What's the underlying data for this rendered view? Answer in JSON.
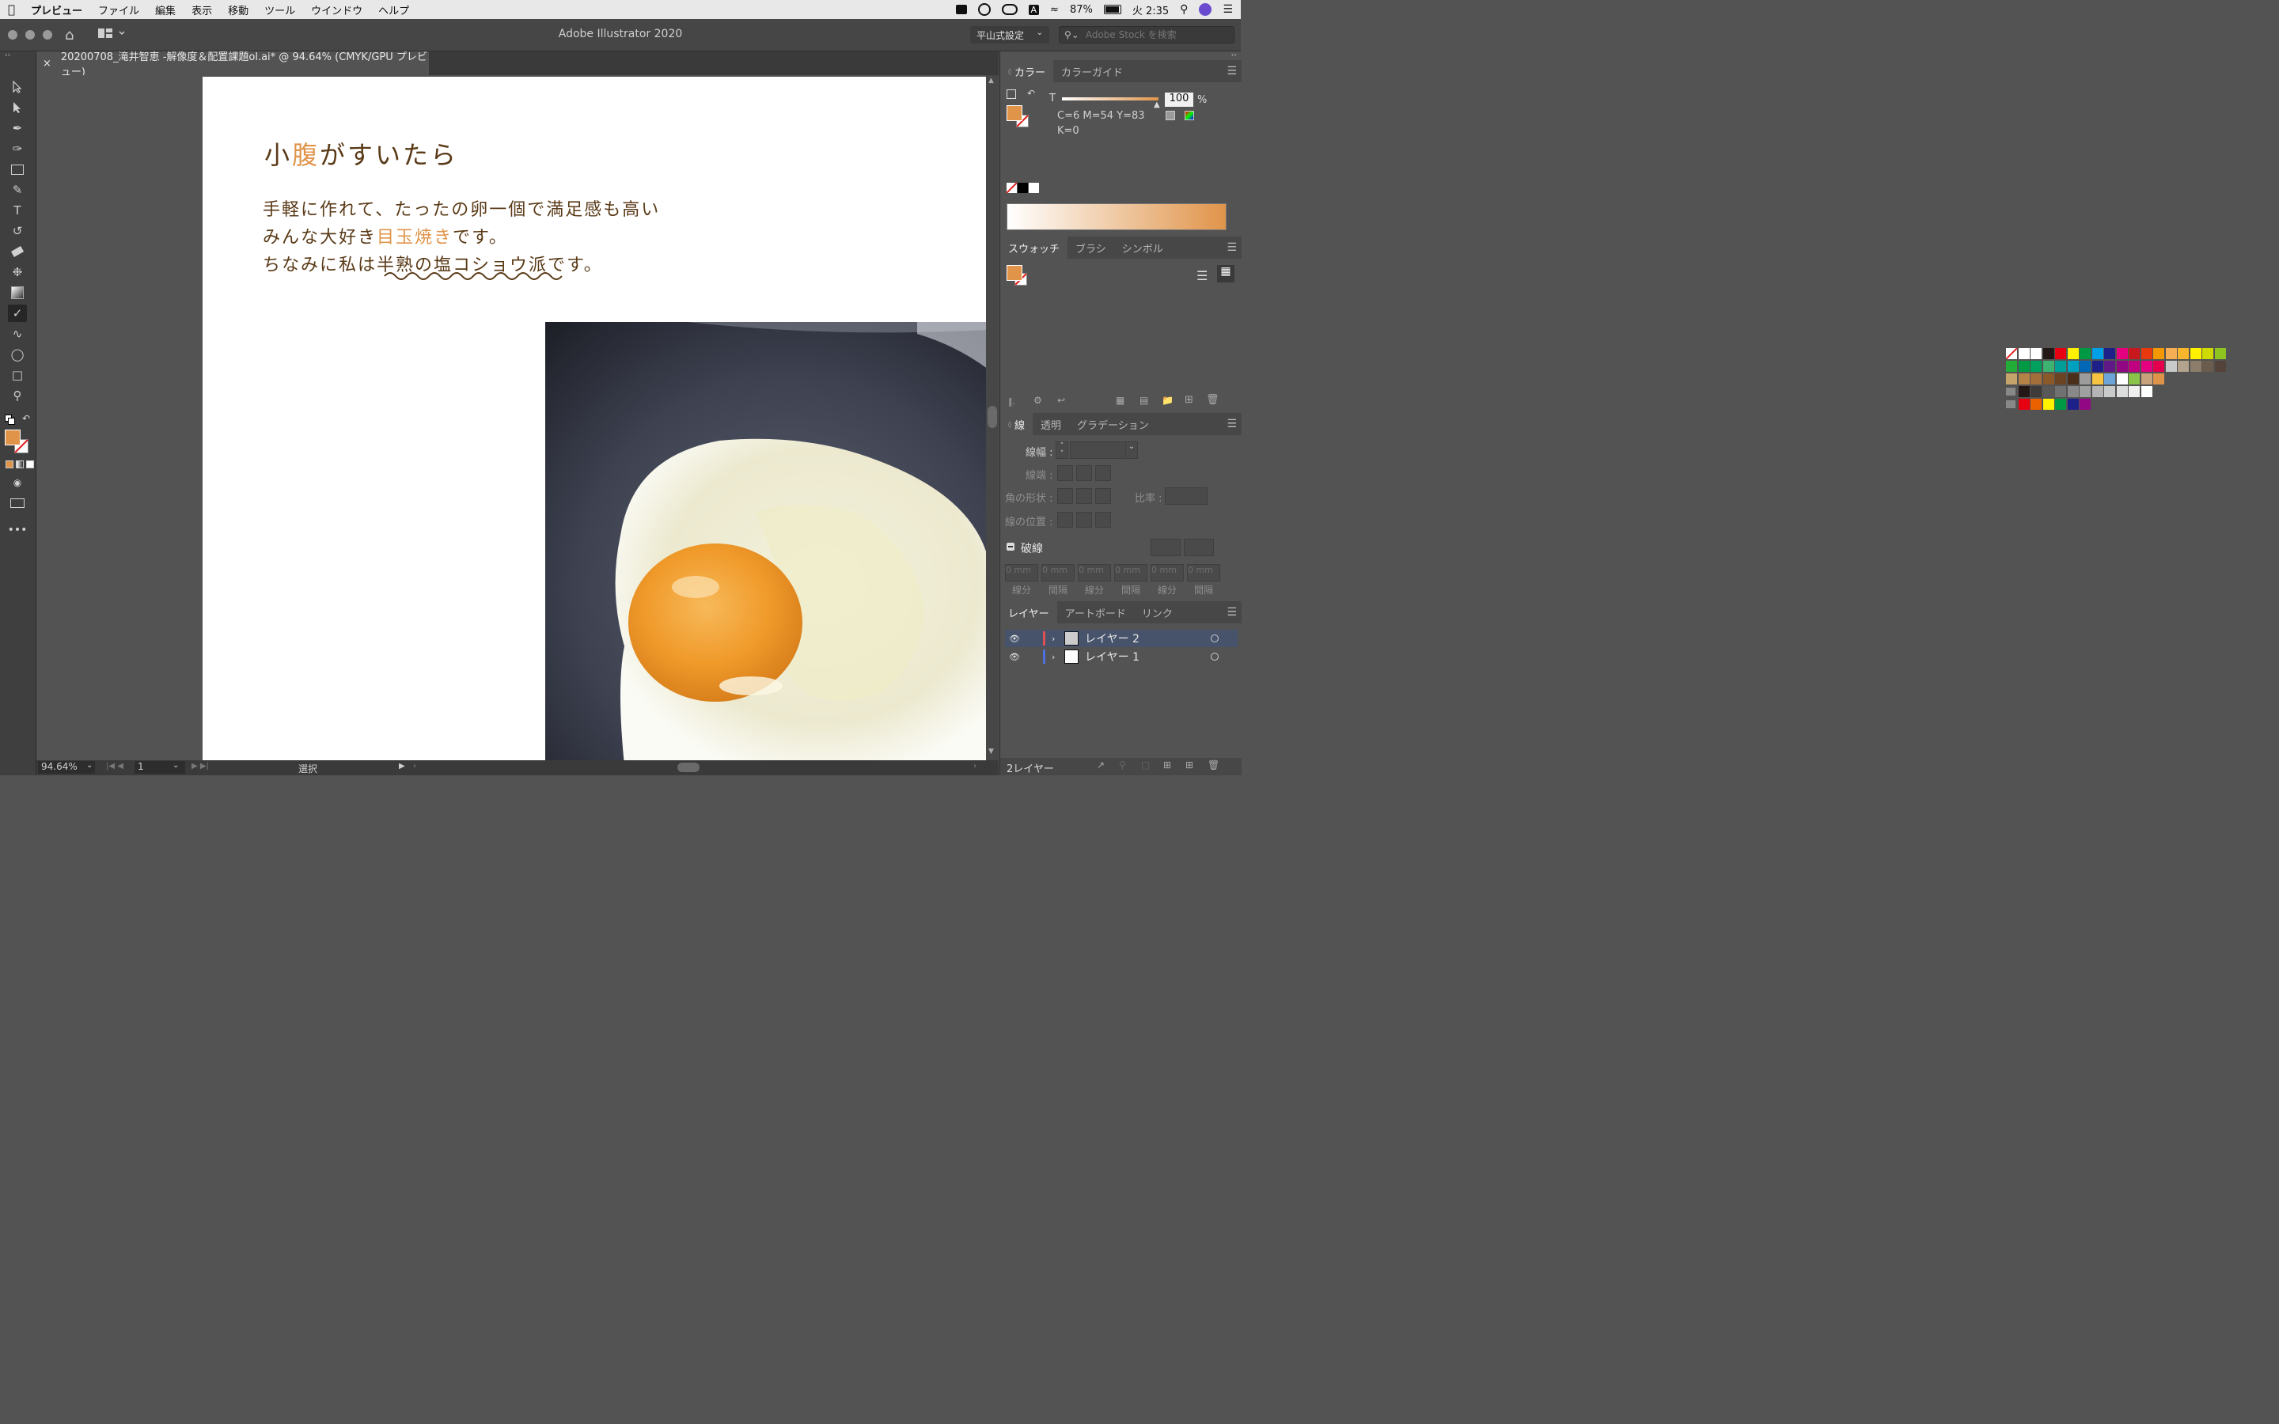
{
  "menubar": {
    "app": "プレビュー",
    "items": [
      "ファイル",
      "編集",
      "表示",
      "移動",
      "ツール",
      "ウインドウ",
      "ヘルプ"
    ],
    "battery": "87%",
    "clock": "火 2:35",
    "input_mode": "A"
  },
  "titlebar": {
    "title": "Adobe Illustrator 2020",
    "workspace": "平山式設定",
    "search_placeholder": "Adobe Stock を検索"
  },
  "document": {
    "tab_title": "20200708_滝井智恵 -解像度＆配置課題ol.ai* @ 94.64% (CMYK/GPU プレビュー)",
    "close_glyph": "×"
  },
  "artwork": {
    "heading_pre": "小",
    "heading_accent": "腹",
    "heading_post": "がすいたら",
    "line1": "手軽に作れて、たったの卵一個で満足感も高い",
    "line2_pre": "みんな大好き",
    "line2_accent": "目玉焼き",
    "line2_post": "です。",
    "line3": "ちなみに私は半熟の塩コショウ派です。",
    "accent_color": "#e0944a",
    "text_color": "#5a3a17"
  },
  "statusbar": {
    "zoom": "94.64%",
    "artboard": "1",
    "tool": "選択"
  },
  "color_panel": {
    "tabs": [
      "カラー",
      "カラーガイド"
    ],
    "channel": "T",
    "tint": "100",
    "unit": "%",
    "values_line1": "C=6 M=54 Y=83",
    "values_line2": "K=0",
    "fill_color": "#e0944a"
  },
  "swatches_panel": {
    "tabs": [
      "スウォッチ",
      "ブラシ",
      "シンボル"
    ],
    "row1": [
      "#ffffff",
      "#ffffff",
      "#ffffff",
      "#231815",
      "#e60012",
      "#fff100",
      "#009944",
      "#00a0e9",
      "#1d2088",
      "#e4007f",
      "#c9171e",
      "#e8380d",
      "#f39800",
      "#f6ae54",
      "#f8b62d",
      "#fff100",
      "#cfdb00",
      "#8fc31f"
    ],
    "row2": [
      "#22ac38",
      "#009944",
      "#00a05e",
      "#3cb371",
      "#009e96",
      "#00a0c1",
      "#0068b7",
      "#1d2088",
      "#601986",
      "#920783",
      "#be0081",
      "#e4007f",
      "#e5004f",
      "#c9caca",
      "#b3a38c",
      "#8c7e6a",
      "#6a5d4d",
      "#54433a"
    ],
    "row3": [
      "#c4a46a",
      "#b28247",
      "#a46e3a",
      "#8b5a2b",
      "#6b4423",
      "#4a2f1b",
      "#9c9c9c",
      "#f6c343",
      "#6ea5d8",
      "#ffffff",
      "#8bc34a",
      "#c8a27a",
      "#e0944a"
    ],
    "row4": [
      "#231815",
      "#3e3a39",
      "#595757",
      "#727171",
      "#898989",
      "#9fa0a0",
      "#b5b5b6",
      "#c9caca",
      "#dcdddd",
      "#efefef",
      "#ffffff"
    ],
    "row5": [
      "#e60012",
      "#eb6100",
      "#fff100",
      "#009944",
      "#1d2088",
      "#920783"
    ]
  },
  "stroke_panel": {
    "tabs": [
      "線",
      "透明",
      "グラデーション"
    ],
    "weight_label": "線幅 :",
    "cap_label": "線端 :",
    "corner_label": "角の形状 :",
    "limit_label": "比率 :",
    "align_label": "線の位置 :",
    "dashed_label": "破線",
    "dash_cells": [
      "0 mm",
      "0 mm",
      "0 mm",
      "0 mm",
      "0 mm",
      "0 mm"
    ],
    "dash_labels": [
      "線分",
      "間隔",
      "線分",
      "間隔",
      "線分",
      "間隔"
    ]
  },
  "layers_panel": {
    "tabs": [
      "レイヤー",
      "アートボード",
      "リンク"
    ],
    "layers": [
      {
        "name": "レイヤー 2",
        "color": "#e05050"
      },
      {
        "name": "レイヤー 1",
        "color": "#4f6fe0"
      }
    ],
    "count": "2レイヤー"
  }
}
